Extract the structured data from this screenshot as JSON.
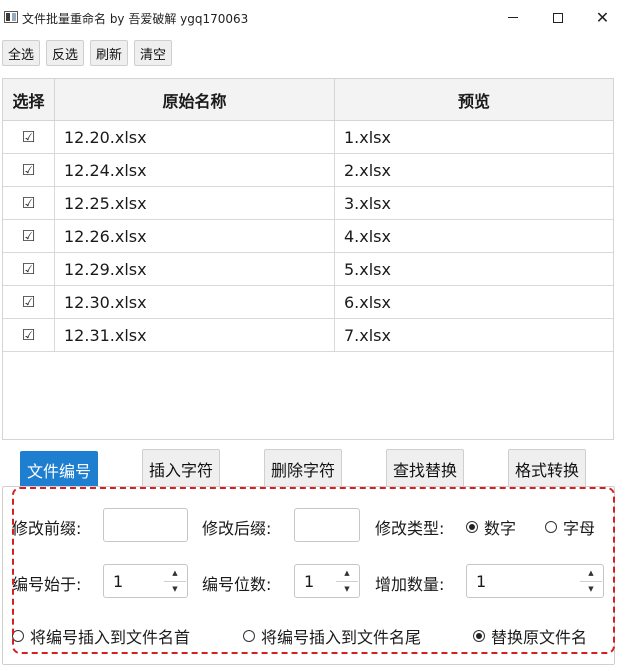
{
  "window": {
    "title": "文件批量重命名 by 吾爱破解 ygq170063",
    "minimize_icon": "minimize-icon",
    "maximize_icon": "maximize-icon",
    "close_icon": "close-icon"
  },
  "toolbar": {
    "select_all": "全选",
    "invert": "反选",
    "refresh": "刷新",
    "clear": "清空"
  },
  "grid": {
    "headers": {
      "select": "选择",
      "original": "原始名称",
      "preview": "预览"
    },
    "rows": [
      {
        "checked": true,
        "original": "12.20.xlsx",
        "preview": "1.xlsx"
      },
      {
        "checked": true,
        "original": "12.24.xlsx",
        "preview": "2.xlsx"
      },
      {
        "checked": true,
        "original": "12.25.xlsx",
        "preview": "3.xlsx"
      },
      {
        "checked": true,
        "original": "12.26.xlsx",
        "preview": "4.xlsx"
      },
      {
        "checked": true,
        "original": "12.29.xlsx",
        "preview": "5.xlsx"
      },
      {
        "checked": true,
        "original": "12.30.xlsx",
        "preview": "6.xlsx"
      },
      {
        "checked": true,
        "original": "12.31.xlsx",
        "preview": "7.xlsx"
      }
    ]
  },
  "tabs": [
    {
      "label": "文件编号",
      "active": true
    },
    {
      "label": "插入字符",
      "active": false
    },
    {
      "label": "删除字符",
      "active": false
    },
    {
      "label": "查找替换",
      "active": false
    },
    {
      "label": "格式转换",
      "active": false
    }
  ],
  "panel": {
    "prefix_label": "修改前缀:",
    "prefix_value": "",
    "suffix_label": "修改后缀:",
    "suffix_value": "",
    "type_label": "修改类型:",
    "type_options": [
      {
        "label": "数字",
        "checked": true
      },
      {
        "label": "字母",
        "checked": false
      }
    ],
    "start_label": "编号始于:",
    "start_value": "1",
    "digits_label": "编号位数:",
    "digits_value": "1",
    "increment_label": "增加数量:",
    "increment_value": "1",
    "position_options": [
      {
        "label": "将编号插入到文件名首",
        "checked": false
      },
      {
        "label": "将编号插入到文件名尾",
        "checked": false
      },
      {
        "label": "替换原文件名",
        "checked": true
      }
    ]
  }
}
